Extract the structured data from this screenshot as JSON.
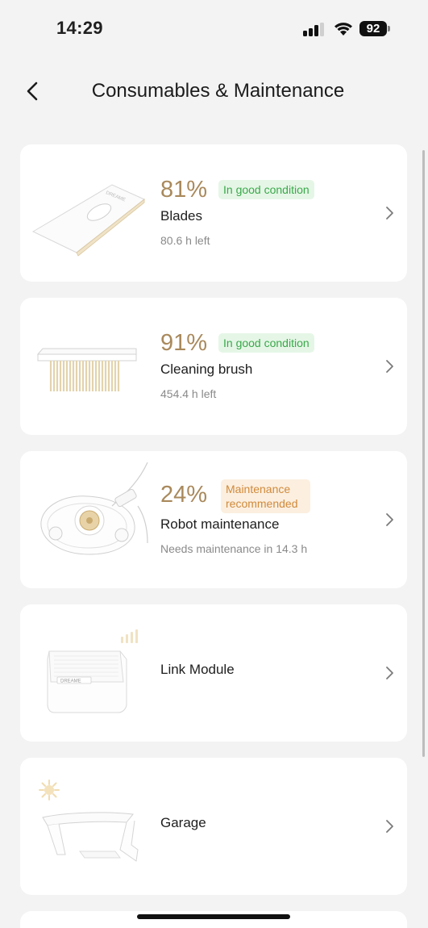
{
  "status_bar": {
    "time": "14:29",
    "battery": "92"
  },
  "header": {
    "title": "Consumables & Maintenance"
  },
  "items": [
    {
      "name": "Blades",
      "percent": "81%",
      "status": "In good condition",
      "status_type": "good",
      "detail": "80.6 h left"
    },
    {
      "name": "Cleaning brush",
      "percent": "91%",
      "status": "In good condition",
      "status_type": "good",
      "detail": "454.4 h left"
    },
    {
      "name": "Robot maintenance",
      "percent": "24%",
      "status_line1": "Maintenance",
      "status_line2": "recommended",
      "status_type": "warning",
      "detail": "Needs maintenance in 14.3 h"
    },
    {
      "name": "Link Module"
    },
    {
      "name": "Garage"
    }
  ],
  "brand_marks": {
    "blade_label": "DREAME",
    "module_label": "DREAME"
  },
  "colors": {
    "accent": "#a9895c",
    "good_text": "#3aa84a",
    "good_bg": "#e5f6e6",
    "warn_text": "#d08a3a",
    "warn_bg": "#fcefe0"
  },
  "icons": [
    "back-chevron-icon",
    "chevron-right-icon",
    "signal-icon",
    "wifi-icon",
    "battery-icon",
    "sun-icon"
  ]
}
